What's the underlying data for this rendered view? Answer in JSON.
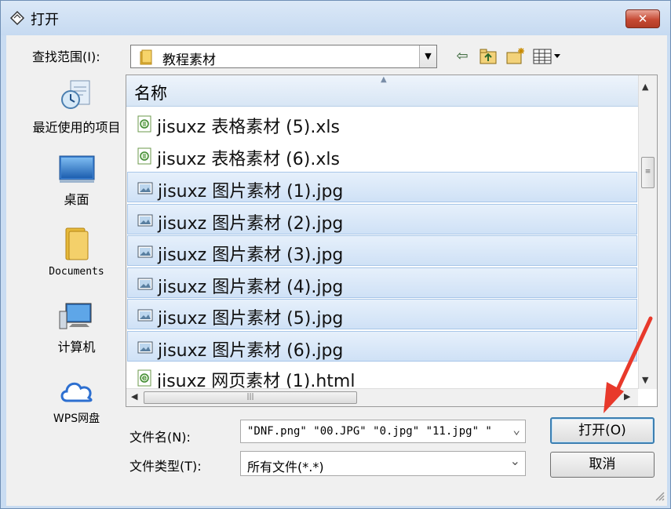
{
  "window": {
    "title": "打开",
    "close_label": "✕"
  },
  "lookin": {
    "label": "查找范围(I):",
    "value": "教程素材"
  },
  "toolbar_icons": [
    "back-icon",
    "up-folder-icon",
    "new-folder-icon",
    "view-menu-icon"
  ],
  "places": [
    {
      "label": "最近使用的项目",
      "icon": "recent-items-icon"
    },
    {
      "label": "桌面",
      "icon": "desktop-icon"
    },
    {
      "label": "Documents",
      "icon": "documents-folder-icon"
    },
    {
      "label": "计算机",
      "icon": "computer-icon"
    },
    {
      "label": "WPS网盘",
      "icon": "cloud-icon"
    }
  ],
  "file_list": {
    "column_header": "名称",
    "rows": [
      {
        "name": "jisuxz 表格素材 (5).xls",
        "type": "xls",
        "selected": false
      },
      {
        "name": "jisuxz 表格素材 (6).xls",
        "type": "xls",
        "selected": false
      },
      {
        "name": "jisuxz 图片素材 (1).jpg",
        "type": "jpg",
        "selected": true
      },
      {
        "name": "jisuxz 图片素材 (2).jpg",
        "type": "jpg",
        "selected": true
      },
      {
        "name": "jisuxz 图片素材 (3).jpg",
        "type": "jpg",
        "selected": true
      },
      {
        "name": "jisuxz 图片素材 (4).jpg",
        "type": "jpg",
        "selected": true
      },
      {
        "name": "jisuxz 图片素材 (5).jpg",
        "type": "jpg",
        "selected": true
      },
      {
        "name": "jisuxz 图片素材 (6).jpg",
        "type": "jpg",
        "selected": true
      },
      {
        "name": "jisuxz 网页素材 (1).html",
        "type": "html",
        "selected": false
      }
    ]
  },
  "filename": {
    "label": "文件名(N):",
    "value": "\"DNF.png\" \"00.JPG\" \"0.jpg\" \"11.jpg\" \""
  },
  "filetype": {
    "label": "文件类型(T):",
    "value": "所有文件(*.*)"
  },
  "buttons": {
    "open": "打开(O)",
    "cancel": "取消"
  },
  "colors": {
    "accent": "#3c7fb1",
    "selection": "#cfe1f6",
    "annotation_arrow": "#e8392b"
  }
}
